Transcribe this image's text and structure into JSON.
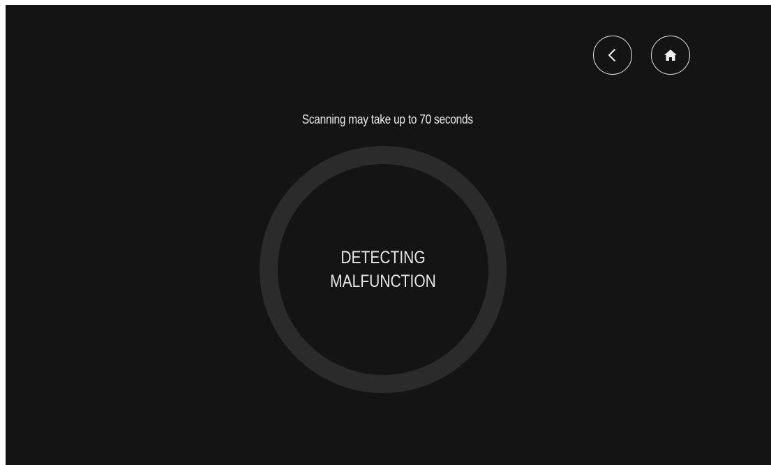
{
  "nav": {
    "back_icon": "chevron-left-icon",
    "home_icon": "home-icon"
  },
  "scan": {
    "hint": "Scanning may take up to 70 seconds",
    "status_line1": "DETECTING",
    "status_line2": "MALFUNCTION"
  },
  "colors": {
    "background": "#141414",
    "ring": "#2b2b2b",
    "text": "#e6e6e6"
  }
}
